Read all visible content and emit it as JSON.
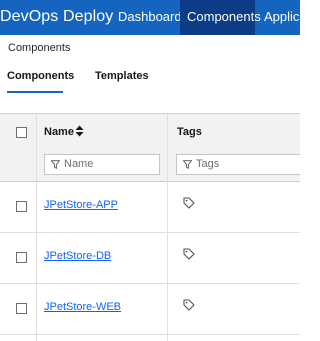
{
  "header": {
    "brand": "DevOps Deploy",
    "nav": [
      {
        "label": "Dashboard",
        "active": false
      },
      {
        "label": "Components",
        "active": true
      },
      {
        "label": "Applica",
        "active": false
      }
    ]
  },
  "breadcrumb": "Components",
  "tabs": [
    {
      "label": "Components",
      "active": true
    },
    {
      "label": "Templates",
      "active": false
    }
  ],
  "table": {
    "columns": [
      {
        "label": "Name",
        "filter_placeholder": "Name",
        "sortable": true
      },
      {
        "label": "Tags",
        "filter_placeholder": "Tags"
      }
    ],
    "rows": [
      {
        "name": "JPetStore-APP"
      },
      {
        "name": "JPetStore-DB"
      },
      {
        "name": "JPetStore-WEB"
      }
    ]
  },
  "icons": {
    "sort": "sort-icon",
    "filter": "filter-icon",
    "tag": "tag-icon"
  },
  "colors": {
    "header_bg": "#1565c0",
    "active_nav_bg": "#0b3c85",
    "link": "#0f62fe",
    "tab_underline": "#1565c0",
    "table_header_bg": "#f2f2f2"
  }
}
